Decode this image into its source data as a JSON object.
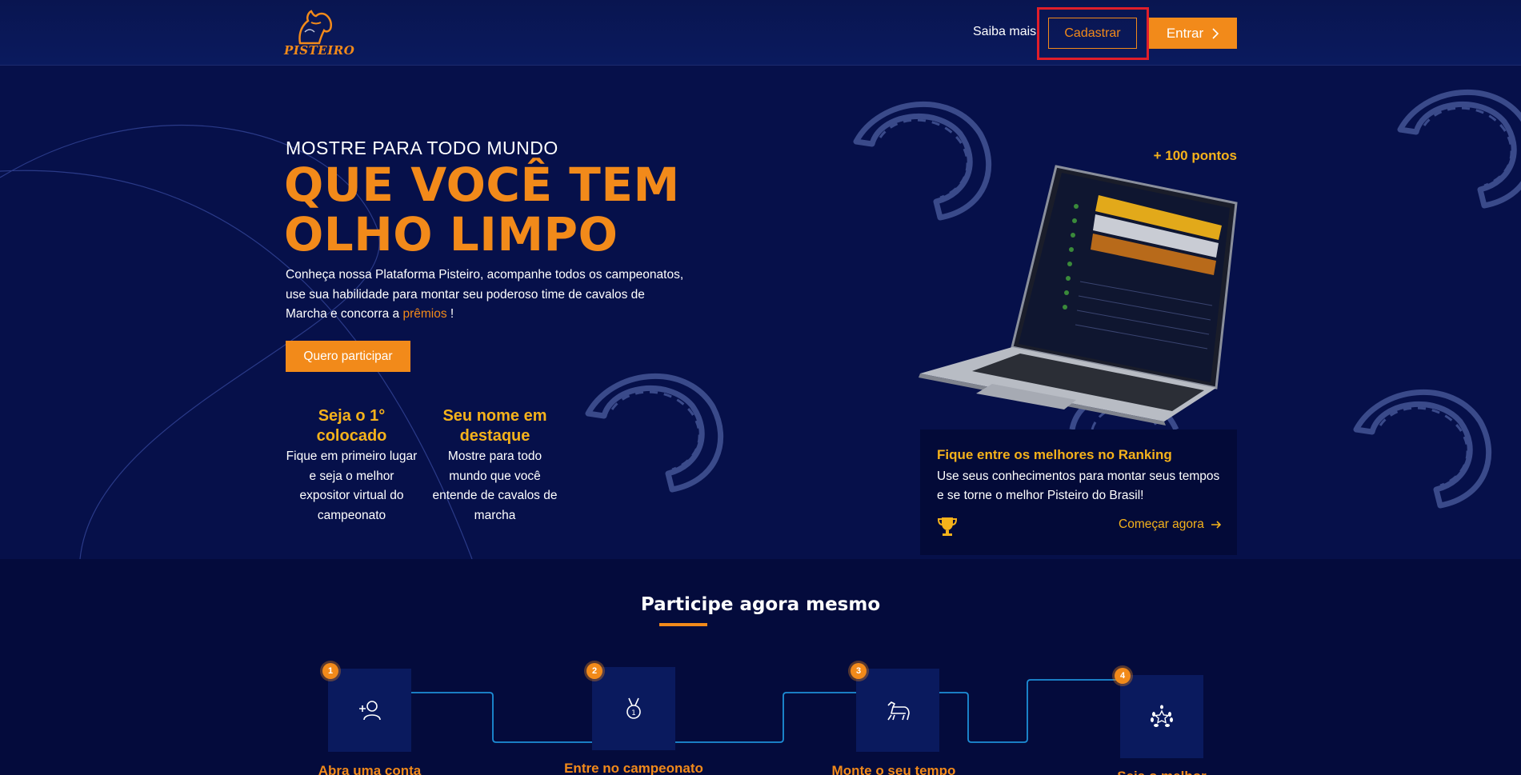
{
  "header": {
    "logo_text": "PISTEIRO",
    "nav_saiba": "Saiba mais",
    "btn_cadastrar": "Cadastrar",
    "btn_entrar": "Entrar",
    "entrar_icon": "chevron-right-icon"
  },
  "hero": {
    "pre_title": "MOSTRE PARA TODO MUNDO",
    "title_line1": "QUE VOCÊ TEM",
    "title_line2": "OLHO LIMPO",
    "desc_before": "Conheça nossa Plataforma Pisteiro, acompanhe todos os campeonatos, use sua habilidade para montar seu poderoso time de cavalos de Marcha e concorra a",
    "desc_highlight": "prêmios",
    "desc_after": "!",
    "cta": "Quero participar",
    "features": [
      {
        "title": "Seja o 1° colocado",
        "text": "Fique em primeiro lugar e seja o melhor expositor virtual do campeonato"
      },
      {
        "title": "Seu nome em destaque",
        "text": "Mostre para todo mundo que você entende de cavalos de marcha"
      }
    ],
    "pontos": "+ 100 pontos"
  },
  "rank_card": {
    "title": "Fique entre os melhores no Ranking",
    "desc": "Use seus conhecimentos para montar seus tempos e se torne o melhor Pisteiro do Brasil!",
    "link": "Começar agora",
    "icon": "trophy-icon",
    "link_icon": "arrow-right-icon"
  },
  "steps": {
    "title": "Participe agora mesmo",
    "items": [
      {
        "num": "1",
        "label": "Abra uma conta",
        "icon": "add-user-icon"
      },
      {
        "num": "2",
        "label": "Entre no campeonato",
        "icon": "medal-icon"
      },
      {
        "num": "3",
        "label": "Monte o seu tempo",
        "icon": "horse-icon"
      },
      {
        "num": "4",
        "label": "Seja o melhor",
        "icon": "laurel-star-icon"
      }
    ]
  },
  "colors": {
    "accent": "#f28a1a",
    "gold": "#f5b21b",
    "background": "#06104a",
    "highlight_border": "#e01e2a"
  }
}
